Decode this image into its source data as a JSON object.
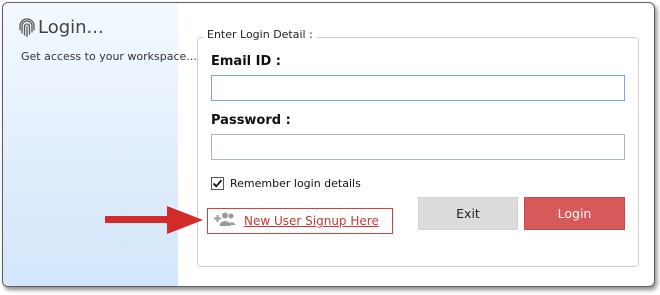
{
  "window": {
    "title": "Login...",
    "subtitle": "Get access to your workspace..."
  },
  "form": {
    "legend": "Enter Login Detail :",
    "email": {
      "label": "Email ID :",
      "value": "",
      "placeholder": ""
    },
    "password": {
      "label": "Password :",
      "value": "",
      "placeholder": ""
    },
    "remember": {
      "label": "Remember login details",
      "checked": true
    }
  },
  "actions": {
    "exit_label": "Exit",
    "login_label": "Login"
  },
  "signup": {
    "label": "New User Signup Here",
    "icon": "add-user-icon"
  },
  "annotation": {
    "icon": "red-arrow-icon",
    "color": "#d42a2a"
  },
  "colors": {
    "login_button": "#d65a5a",
    "exit_button": "#dcdcdc",
    "signup_accent": "#c93a3a"
  }
}
